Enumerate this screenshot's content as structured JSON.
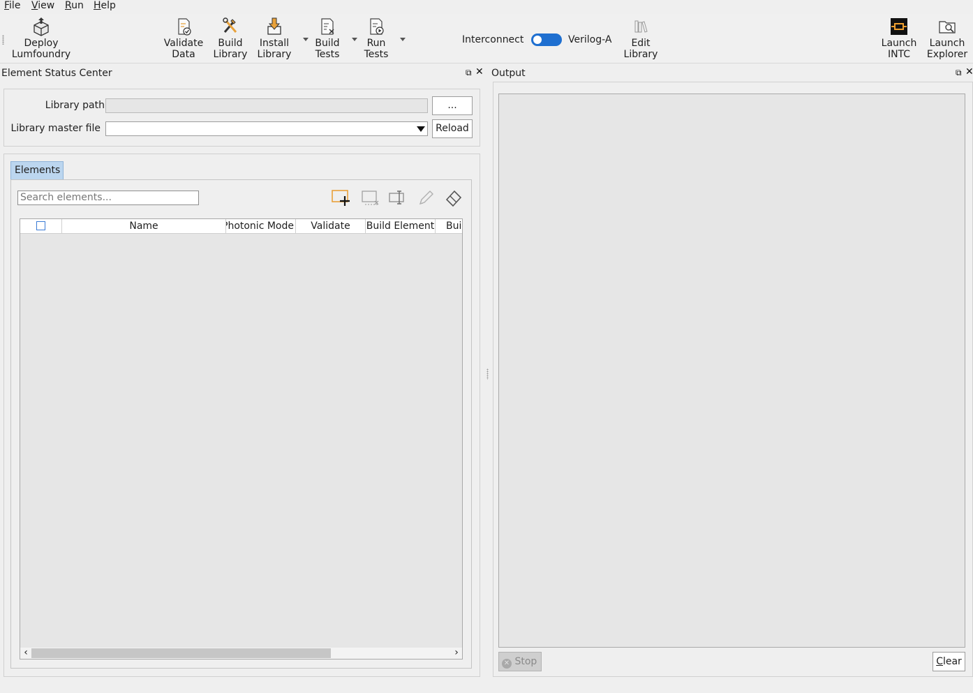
{
  "menu": {
    "items": [
      {
        "accel": "F",
        "rest": "ile"
      },
      {
        "accel": "V",
        "rest": "iew"
      },
      {
        "accel": "R",
        "rest": "un"
      },
      {
        "accel": "H",
        "rest": "elp"
      }
    ]
  },
  "toolbar": {
    "deploy": "Deploy\nLumfoundry",
    "validate": "Validate\nData",
    "build_library": "Build\nLibrary",
    "install_library": "Install\nLibrary",
    "build_tests": "Build\nTests",
    "run_tests": "Run\nTests",
    "switch_left": "Interconnect",
    "switch_right": "Verilog-A",
    "edit_library": "Edit\nLibrary",
    "launch_intc": "Launch\nINTC",
    "launch_explorer": "Launch\nExplorer"
  },
  "element_status": {
    "title": "Element Status Center",
    "library_path_label": "Library path",
    "library_path_value": "",
    "browse_label": "...",
    "master_file_label": "Library master file",
    "master_file_value": "",
    "reload_label": "Reload",
    "tab_label": "Elements",
    "search_placeholder": "Search elements...",
    "columns": [
      "Name",
      "Photonic Mode",
      "Validate",
      "Build Element",
      "Bui"
    ],
    "rows": []
  },
  "output": {
    "title": "Output",
    "stop_label": "Stop",
    "clear_accel": "C",
    "clear_rest": "lear"
  },
  "colors": {
    "accent": "#1e6fd0",
    "tab_active": "#bcd6ef",
    "add_icon": "#e8a13a"
  }
}
